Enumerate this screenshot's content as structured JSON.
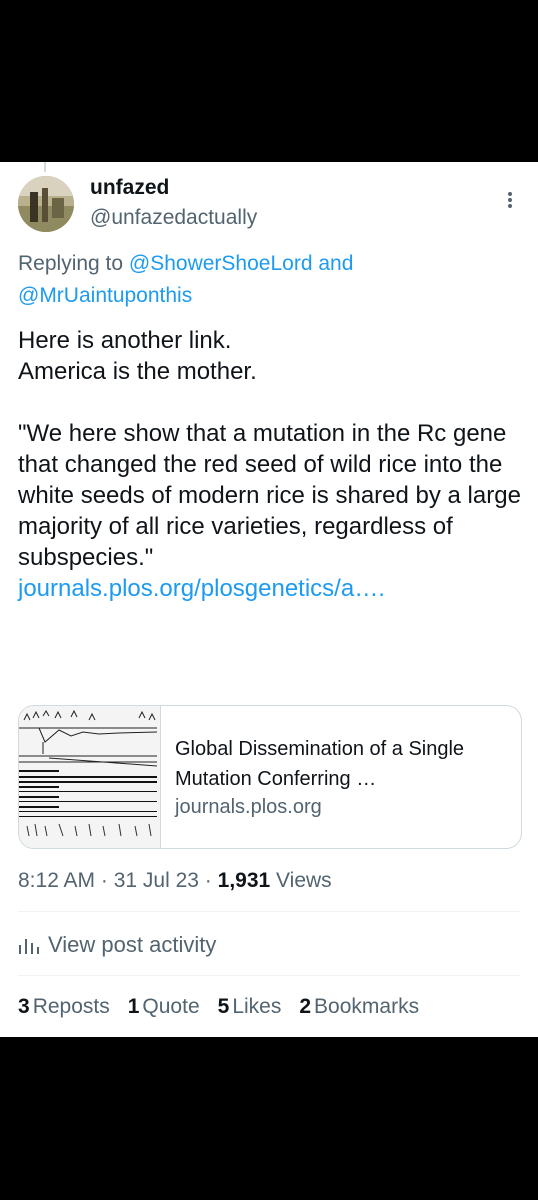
{
  "tweet": {
    "display_name": "unfazed",
    "handle": "@unfazedactually",
    "replying_prefix": "Replying to ",
    "reply_to_1": "@ShowerShoeLord",
    "reply_and": " and",
    "reply_to_2": "@MrUaintuponthis",
    "text": "Here is another link.\nAmerica is the mother.\n\n\"We here show that a mutation in the Rc gene that changed the red seed of wild rice into the white seeds of modern rice is shared by a large majority of all rice varieties, regardless of subspecies.\"",
    "link_text": "journals.plos.org/plosgenetics/a…."
  },
  "link_card": {
    "title": "Global Dissemination of a Single Mutation Conferring …",
    "domain": "journals.plos.org"
  },
  "meta": {
    "time": "8:12 AM",
    "dot": " · ",
    "date": "31 Jul 23",
    "views_count": "1,931",
    "views_label": " Views"
  },
  "activity": {
    "label": "View post activity",
    "icon": "bar-chart-icon"
  },
  "stats": {
    "reposts_count": "3",
    "reposts_label": "Reposts",
    "quotes_count": "1",
    "quotes_label": "Quote",
    "likes_count": "5",
    "likes_label": "Likes",
    "bookmarks_count": "2",
    "bookmarks_label": "Bookmarks"
  },
  "colors": {
    "accent": "#1d9bf0",
    "text": "#0f1419",
    "muted": "#536471",
    "border": "#cfd9de"
  }
}
